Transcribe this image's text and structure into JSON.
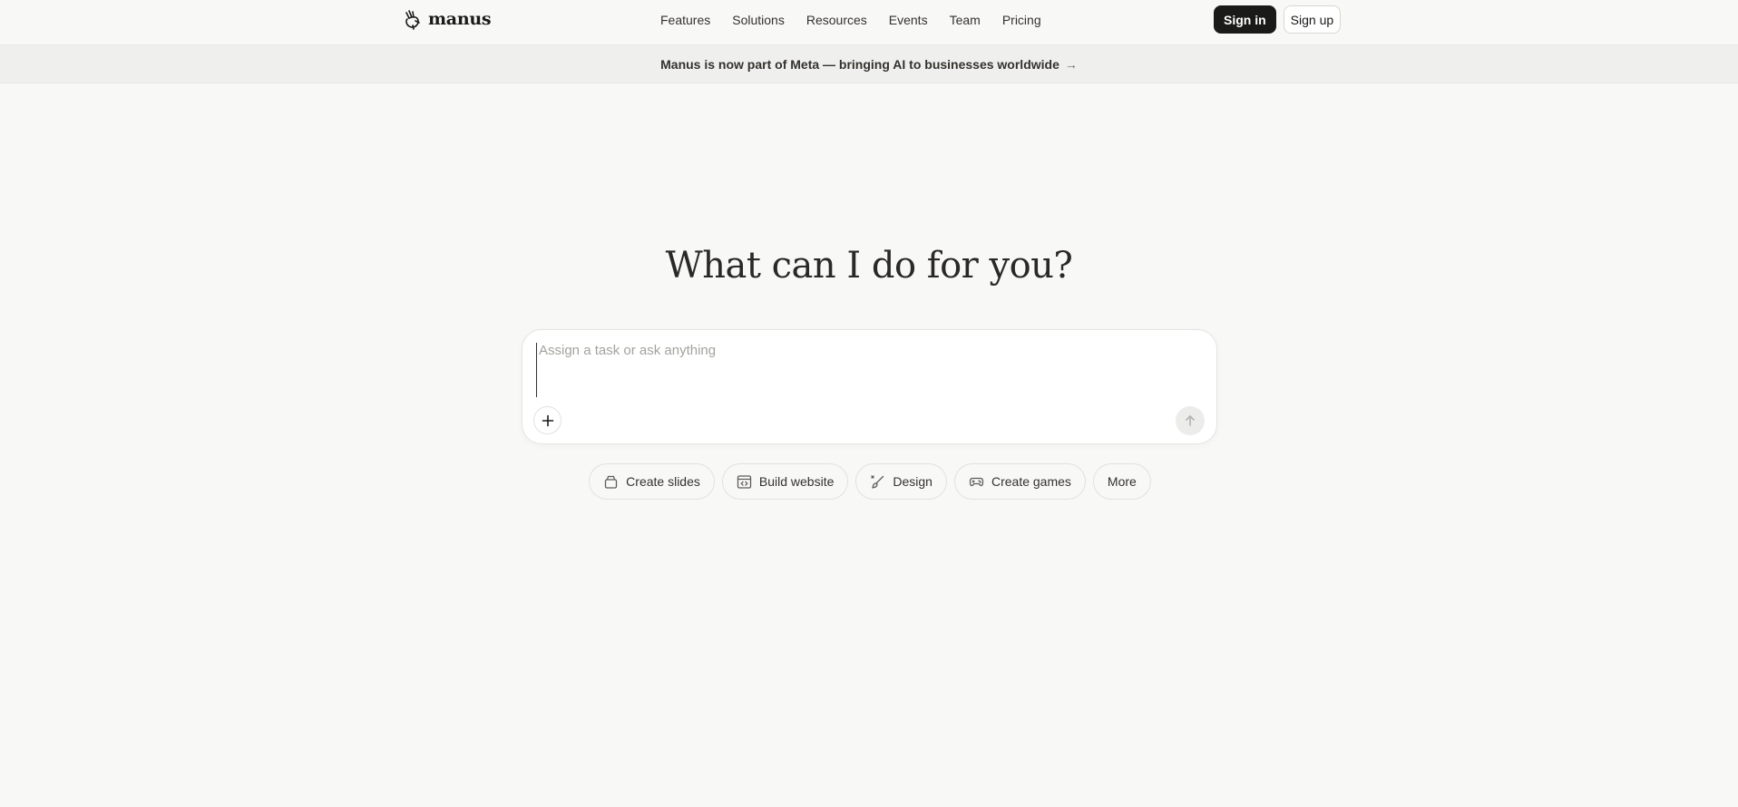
{
  "header": {
    "brand": "manus",
    "nav": [
      {
        "label": "Features"
      },
      {
        "label": "Solutions"
      },
      {
        "label": "Resources"
      },
      {
        "label": "Events"
      },
      {
        "label": "Team"
      },
      {
        "label": "Pricing"
      }
    ],
    "sign_in_label": "Sign in",
    "sign_up_label": "Sign up"
  },
  "banner": {
    "text": "Manus is now part of Meta — bringing AI to businesses worldwide",
    "arrow_icon": "arrow-right-icon"
  },
  "hero": {
    "title": "What can I do for you?"
  },
  "prompt": {
    "placeholder": "Assign a task or ask anything",
    "value": "",
    "attach_icon": "plus-icon",
    "send_icon": "arrow-up-icon"
  },
  "suggestions": [
    {
      "label": "Create slides",
      "icon": "slides-icon"
    },
    {
      "label": "Build website",
      "icon": "code-window-icon"
    },
    {
      "label": "Design",
      "icon": "design-brush-icon"
    },
    {
      "label": "Create games",
      "icon": "gamepad-icon"
    },
    {
      "label": "More",
      "icon": ""
    }
  ],
  "colors": {
    "background": "#f8f8f7",
    "banner_background": "#efefed",
    "primary_button": "#1a1a19",
    "text": "#34322d",
    "placeholder": "#a3a29e"
  }
}
